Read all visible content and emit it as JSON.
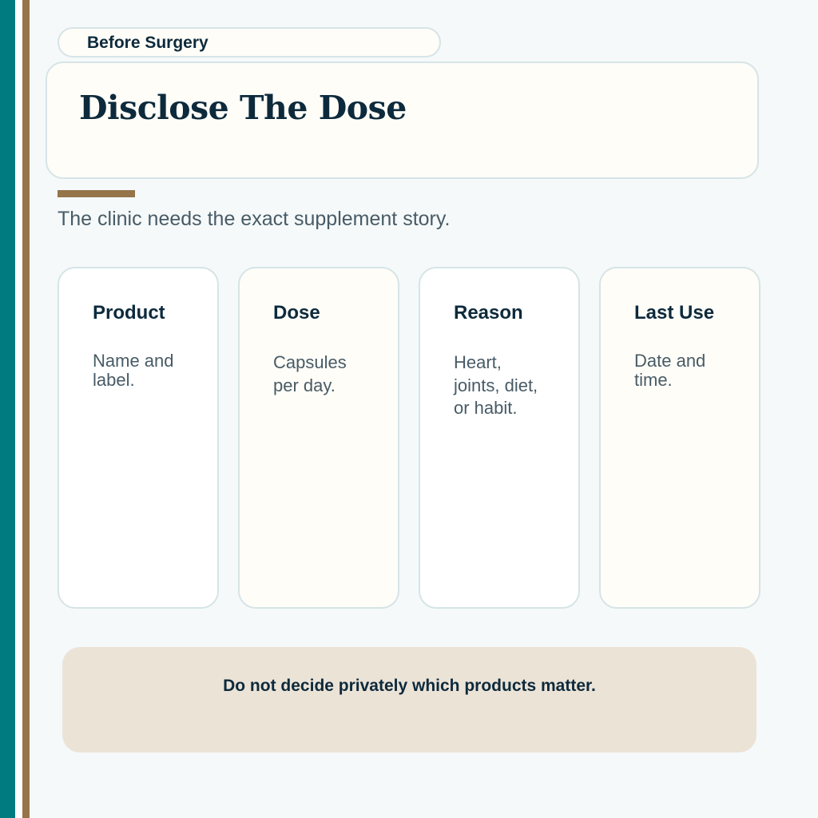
{
  "eyebrow": "Before Surgery",
  "title": "Disclose The Dose",
  "subtitle": "The clinic needs the exact supplement story.",
  "cards": [
    {
      "heading": "Product",
      "body": "Name and label."
    },
    {
      "heading": "Dose",
      "body": "Capsules per day."
    },
    {
      "heading": "Reason",
      "body": "Heart, joints, diet, or habit."
    },
    {
      "heading": "Last Use",
      "body": "Date and time."
    }
  ],
  "note": "Do not decide privately which products matter.",
  "colors": {
    "teal": "#007b7f",
    "bronze": "#95744a",
    "navy": "#0d2a3c",
    "cream": "#fffdf8",
    "note_bg": "#ece3d7"
  }
}
